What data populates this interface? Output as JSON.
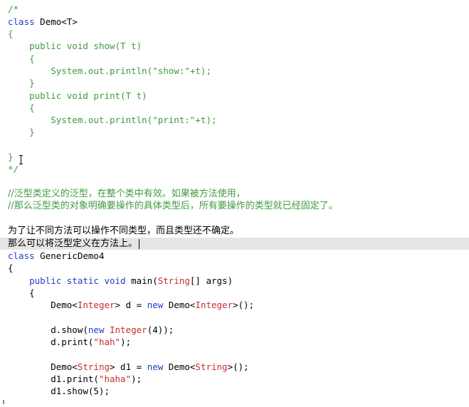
{
  "colors": {
    "comment": "#3f9b3f",
    "keyword": "#1f3fc6",
    "type": "#cc2b2b",
    "string": "#cc2b2b",
    "plain": "#000000",
    "current_line": "#e6e6e6"
  },
  "code": {
    "l01": "/*",
    "l02_kw": "class",
    "l02_rest": " Demo<T>",
    "l03": "{",
    "l04_kw": "    public void",
    "l04_rest": " show(T t)",
    "l05": "    {",
    "l06": "        System.out.println(\"show:\"+t);",
    "l07": "    }",
    "l08_kw": "    public void",
    "l08_rest": " print(T t)",
    "l09": "    {",
    "l10": "        System.out.println(\"print:\"+t);",
    "l11": "    }",
    "l12": "",
    "l13": "}",
    "l14": "*/",
    "l15": "",
    "l16": "//泛型类定义的泛型，在整个类中有效。如果被方法使用，",
    "l17": "//那么泛型类的对象明确要操作的具体类型后，所有要操作的类型就已经固定了。",
    "l18": "",
    "l19": "为了让不同方法可以操作不同类型，而且类型还不确定。",
    "l20": "那么可以将泛型定义在方法上。",
    "l21_kw": "class",
    "l21_rest": " GenericDemo4",
    "l22": "{",
    "l23_kw": "    public static void",
    "l23_mid": " main(",
    "l23_ty": "String",
    "l23_rest": "[] args)",
    "l24": "    {",
    "l25_a": "        Demo<",
    "l25_ty1": "Integer",
    "l25_b": "> d = ",
    "l25_kw": "new",
    "l25_c": " Demo<",
    "l25_ty2": "Integer",
    "l25_d": ">();",
    "l26": "",
    "l27_a": "        d.show(",
    "l27_kw": "new",
    "l27_b": " ",
    "l27_ty": "Integer",
    "l27_c": "(4));",
    "l28_a": "        d.print(",
    "l28_st": "\"hah\"",
    "l28_b": ");",
    "l29": "",
    "l30_a": "        Demo<",
    "l30_ty1": "String",
    "l30_b": "> d1 = ",
    "l30_kw": "new",
    "l30_c": " Demo<",
    "l30_ty2": "String",
    "l30_d": ">();",
    "l31_a": "        d1.print(",
    "l31_st": "\"haha\"",
    "l31_b": ");",
    "l32": "        d1.show(5);"
  }
}
